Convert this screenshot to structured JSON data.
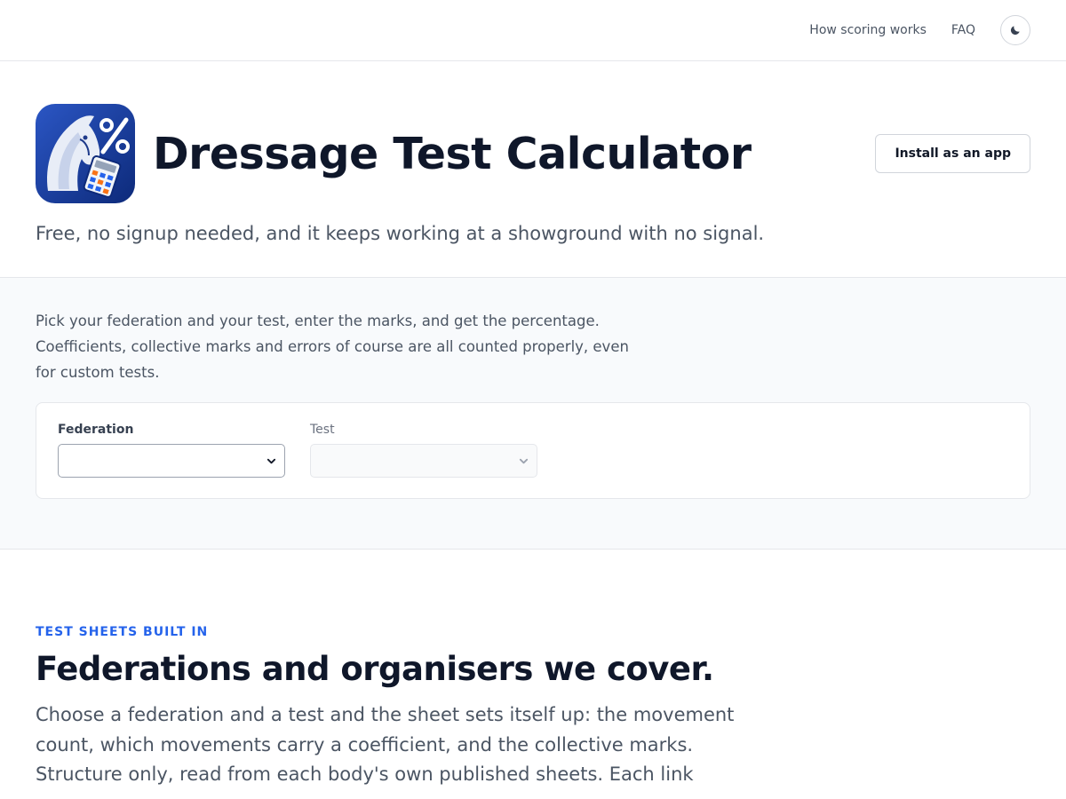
{
  "nav": {
    "how_scoring": "How scoring works",
    "faq": "FAQ",
    "theme_icon": "moon-icon"
  },
  "hero": {
    "logo_icon": "horse-calculator-percent-icon",
    "title": "Dressage Test Calculator",
    "install_label": "Install as an app",
    "subtitle": "Free, no signup needed, and it keeps working at a showground with no signal."
  },
  "calculator": {
    "intro": "Pick your federation and your test, enter the marks, and get the percentage. Coefficients, collective marks and errors of course are all counted properly, even for custom tests.",
    "federation_label": "Federation",
    "federation_value": "",
    "test_label": "Test",
    "test_value": ""
  },
  "coverage": {
    "eyebrow": "TEST SHEETS BUILT IN",
    "title": "Federations and organisers we cover.",
    "text": "Choose a federation and a test and the sheet sets itself up: the movement count, which movements carry a coefficient, and the collective marks. Structure only, read from each body's own published sheets. Each link"
  },
  "colors": {
    "accent": "#2563eb",
    "logo_blue": "#1e3a8a"
  }
}
